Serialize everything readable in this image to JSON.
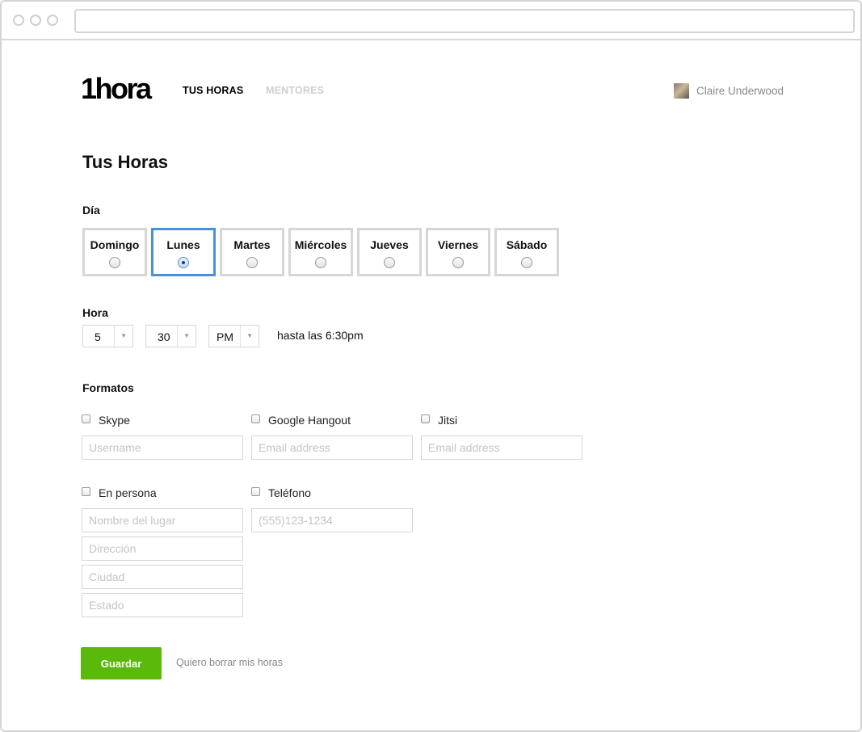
{
  "browser": {
    "url": ""
  },
  "header": {
    "logo": "1hora",
    "nav": [
      {
        "label": "TUS HORAS"
      },
      {
        "label": "MENTORES"
      }
    ],
    "user_name": "Claire Underwood"
  },
  "page": {
    "title": "Tus Horas",
    "day_label": "Día",
    "days": [
      {
        "label": "Domingo",
        "selected": false
      },
      {
        "label": "Lunes",
        "selected": true
      },
      {
        "label": "Martes",
        "selected": false
      },
      {
        "label": "Miércoles",
        "selected": false
      },
      {
        "label": "Jueves",
        "selected": false
      },
      {
        "label": "Viernes",
        "selected": false
      },
      {
        "label": "Sábado",
        "selected": false
      }
    ],
    "hour_label": "Hora",
    "hour": "5",
    "minute": "30",
    "ampm": "PM",
    "until_text": "hasta las 6:30pm",
    "formats_label": "Formatos",
    "formats": {
      "skype": {
        "label": "Skype",
        "placeholder": "Username",
        "value": ""
      },
      "hangout": {
        "label": "Google Hangout",
        "placeholder": "Email address",
        "value": ""
      },
      "jitsi": {
        "label": "Jitsi",
        "placeholder": "Email address",
        "value": ""
      },
      "en_persona": {
        "label": "En persona",
        "place_placeholder": "Nombre del lugar",
        "address_placeholder": "Dirección",
        "city_placeholder": "Ciudad",
        "state_placeholder": "Estado"
      },
      "telefono": {
        "label": "Teléfono",
        "placeholder": "(555)123-1234",
        "value": ""
      }
    },
    "save_label": "Guardar",
    "delete_link": "Quiero borrar mis horas"
  },
  "colors": {
    "accent_blue": "#4a90e2",
    "save_green": "#5ab90b"
  }
}
